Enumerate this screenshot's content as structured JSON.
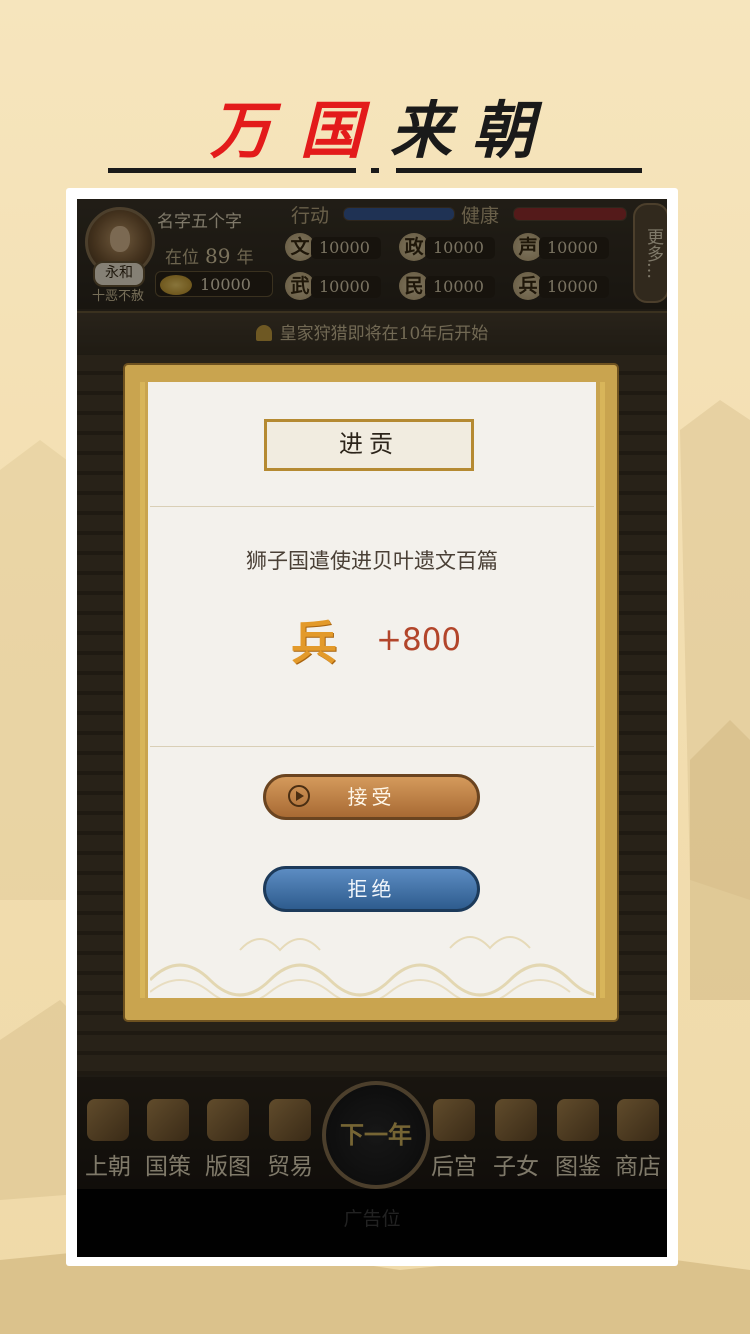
{
  "page_title": {
    "chars": [
      "万",
      "国",
      "来",
      "朝"
    ],
    "colors": [
      "#e31b1b",
      "#e31b1b",
      "#1a1a1a",
      "#1a1a1a"
    ]
  },
  "header": {
    "name": "名字五个字",
    "reign_title": "永和",
    "motto": "十恶不赦",
    "zaiwei_prefix": "在位",
    "years": "89",
    "years_suffix": "年",
    "coins": "10000",
    "action_label": "行动",
    "health_label": "健康",
    "more_label": "更多…",
    "stats": [
      {
        "icon": "文",
        "value": "10000"
      },
      {
        "icon": "政",
        "value": "10000"
      },
      {
        "icon": "声",
        "value": "10000"
      },
      {
        "icon": "武",
        "value": "10000"
      },
      {
        "icon": "民",
        "value": "10000"
      },
      {
        "icon": "兵",
        "value": "10000"
      }
    ]
  },
  "notice": "皇家狩猎即将在10年后开始",
  "dialog": {
    "title": "进贡",
    "message": "狮子国遣使进贝叶遗文百篇",
    "reward_icon": "兵",
    "reward_value": "+800",
    "accept_label": "接受",
    "reject_label": "拒绝"
  },
  "nav": {
    "items": [
      "上朝",
      "国策",
      "版图",
      "贸易",
      "后宫",
      "子女",
      "图鉴",
      "商店"
    ],
    "next_year": "下一年"
  },
  "ad_label": "广告位",
  "colors": {
    "action_bar": "#3a5c9a",
    "health_bar": "#9a3030",
    "accept": "#b8743c",
    "reject": "#3d6ea3",
    "gold": "#c9a44f"
  }
}
